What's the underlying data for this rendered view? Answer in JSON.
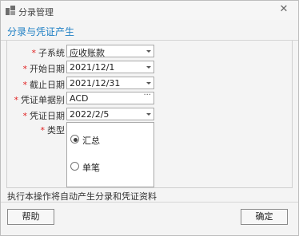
{
  "window": {
    "title": "分录管理",
    "close_symbol": "✕"
  },
  "heading": "分录与凭证产生",
  "form": {
    "rows": [
      {
        "label": "子系统",
        "value": "应收账款",
        "required": true,
        "control": "dropdown"
      },
      {
        "label": "开始日期",
        "value": "2021/12/1",
        "required": true,
        "control": "dropdown"
      },
      {
        "label": "截止日期",
        "value": "2021/12/31",
        "required": true,
        "control": "dropdown"
      },
      {
        "label": "凭证单据别",
        "value": "ACD",
        "required": true,
        "control": "ellipsis"
      },
      {
        "label": "凭证日期",
        "value": "2022/2/5",
        "required": true,
        "control": "dropdown"
      }
    ],
    "type": {
      "label": "类型",
      "required": true,
      "options": [
        {
          "label": "汇总",
          "selected": true
        },
        {
          "label": "单笔",
          "selected": false
        }
      ]
    },
    "required_mark": "*",
    "ellipsis_symbol": "···"
  },
  "info_text": "执行本操作将自动产生分录和凭证资料",
  "buttons": {
    "help": "帮助",
    "ok": "确定"
  },
  "colors": {
    "heading": "#1e7fc4",
    "required": "#e02020"
  }
}
